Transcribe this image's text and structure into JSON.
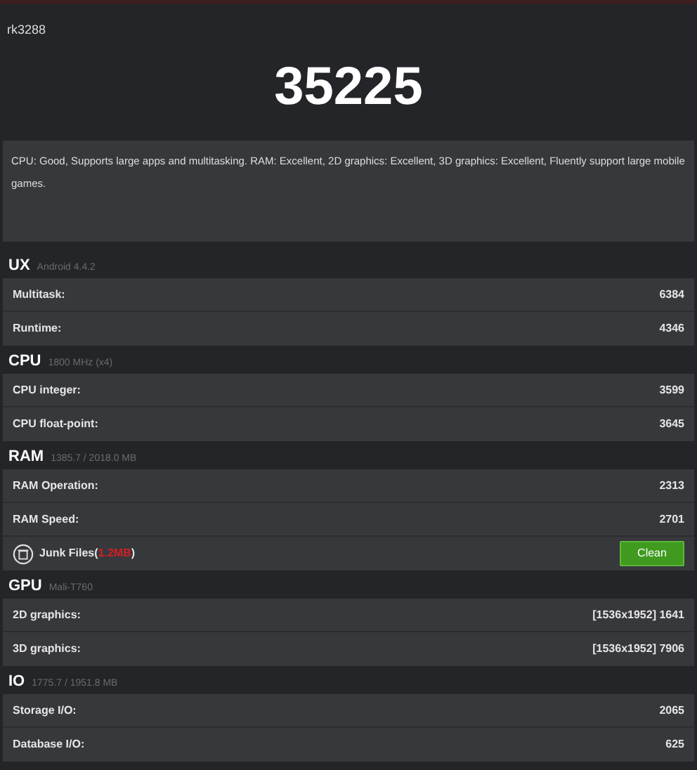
{
  "device": "rk3288",
  "score": "35225",
  "summary": "CPU: Good, Supports large apps and multitasking. RAM: Excellent, 2D graphics: Excellent, 3D graphics: Excellent, Fluently support large mobile games.",
  "sections": [
    {
      "title": "UX",
      "subtitle": "Android 4.4.2",
      "rows": [
        {
          "kind": "stat",
          "label": "Multitask:",
          "value": "6384"
        },
        {
          "kind": "stat",
          "label": "Runtime:",
          "value": "4346"
        }
      ]
    },
    {
      "title": "CPU",
      "subtitle": "1800 MHz (x4)",
      "rows": [
        {
          "kind": "stat",
          "label": "CPU integer:",
          "value": "3599"
        },
        {
          "kind": "stat",
          "label": "CPU float-point:",
          "value": "3645"
        }
      ]
    },
    {
      "title": "RAM",
      "subtitle": "1385.7 / 2018.0 MB",
      "rows": [
        {
          "kind": "stat",
          "label": "RAM Operation:",
          "value": "2313"
        },
        {
          "kind": "stat",
          "label": "RAM Speed:",
          "value": "2701"
        },
        {
          "kind": "junk",
          "label": "Junk Files(",
          "size": "1.2MB",
          "label_end": ")",
          "button": "Clean"
        }
      ]
    },
    {
      "title": "GPU",
      "subtitle": "Mali-T760",
      "rows": [
        {
          "kind": "stat",
          "label": "2D graphics:",
          "value": "[1536x1952] 1641"
        },
        {
          "kind": "stat",
          "label": "3D graphics:",
          "value": "[1536x1952] 7906"
        }
      ]
    },
    {
      "title": "IO",
      "subtitle": "1775.7 / 1951.8 MB",
      "rows": [
        {
          "kind": "stat",
          "label": "Storage I/O:",
          "value": "2065"
        },
        {
          "kind": "stat",
          "label": "Database I/O:",
          "value": "625"
        }
      ]
    }
  ]
}
